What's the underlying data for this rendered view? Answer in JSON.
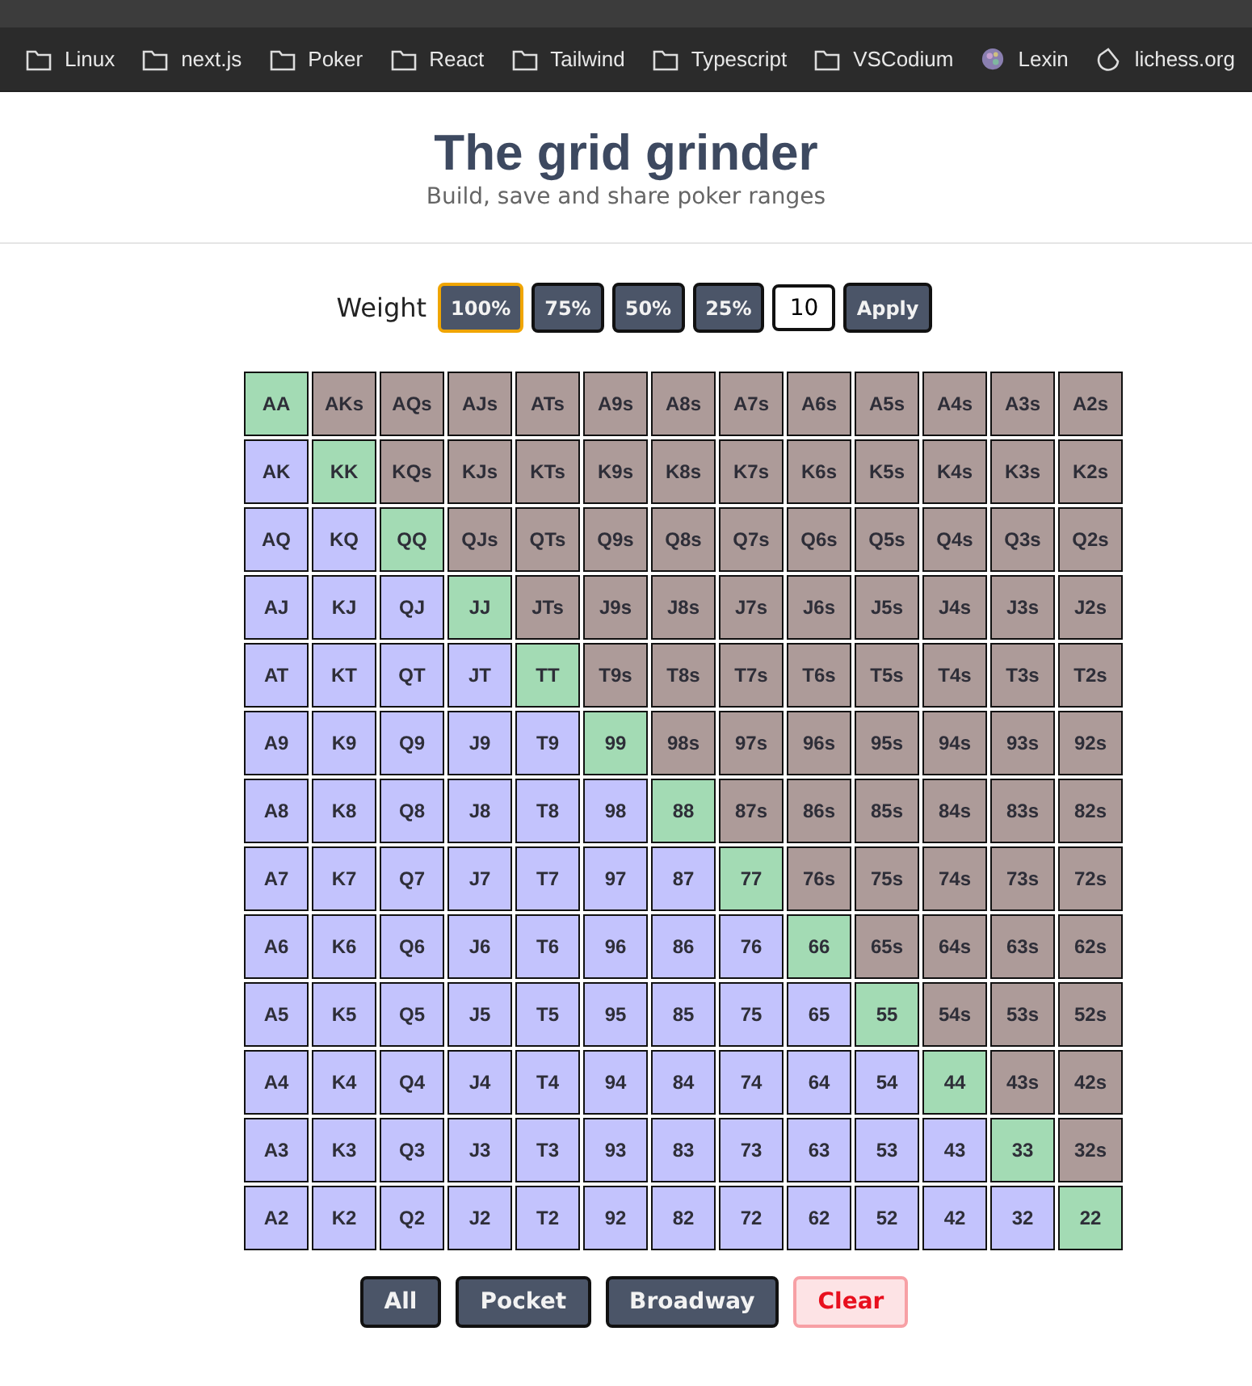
{
  "bookmarks": [
    {
      "label": "Linux",
      "kind": "folder"
    },
    {
      "label": "next.js",
      "kind": "folder"
    },
    {
      "label": "Poker",
      "kind": "folder"
    },
    {
      "label": "React",
      "kind": "folder"
    },
    {
      "label": "Tailwind",
      "kind": "folder"
    },
    {
      "label": "Typescript",
      "kind": "folder"
    },
    {
      "label": "VSCodium",
      "kind": "folder"
    },
    {
      "label": "Lexin",
      "kind": "site"
    },
    {
      "label": "lichess.org",
      "kind": "chess"
    }
  ],
  "header": {
    "title": "The grid grinder",
    "subtitle": "Build, save and share poker ranges"
  },
  "weight": {
    "label": "Weight",
    "options": [
      {
        "label": "100%",
        "selected": true
      },
      {
        "label": "75%",
        "selected": false
      },
      {
        "label": "50%",
        "selected": false
      },
      {
        "label": "25%",
        "selected": false
      }
    ],
    "value": "10",
    "apply": "Apply"
  },
  "grid": [
    [
      {
        "label": "AA",
        "kind": "pair"
      },
      {
        "label": "AKs",
        "kind": "suited"
      },
      {
        "label": "AQs",
        "kind": "suited"
      },
      {
        "label": "AJs",
        "kind": "suited"
      },
      {
        "label": "ATs",
        "kind": "suited"
      },
      {
        "label": "A9s",
        "kind": "suited"
      },
      {
        "label": "A8s",
        "kind": "suited"
      },
      {
        "label": "A7s",
        "kind": "suited"
      },
      {
        "label": "A6s",
        "kind": "suited"
      },
      {
        "label": "A5s",
        "kind": "suited"
      },
      {
        "label": "A4s",
        "kind": "suited"
      },
      {
        "label": "A3s",
        "kind": "suited"
      },
      {
        "label": "A2s",
        "kind": "suited"
      }
    ],
    [
      {
        "label": "AK",
        "kind": "offsuit"
      },
      {
        "label": "KK",
        "kind": "pair"
      },
      {
        "label": "KQs",
        "kind": "suited"
      },
      {
        "label": "KJs",
        "kind": "suited"
      },
      {
        "label": "KTs",
        "kind": "suited"
      },
      {
        "label": "K9s",
        "kind": "suited"
      },
      {
        "label": "K8s",
        "kind": "suited"
      },
      {
        "label": "K7s",
        "kind": "suited"
      },
      {
        "label": "K6s",
        "kind": "suited"
      },
      {
        "label": "K5s",
        "kind": "suited"
      },
      {
        "label": "K4s",
        "kind": "suited"
      },
      {
        "label": "K3s",
        "kind": "suited"
      },
      {
        "label": "K2s",
        "kind": "suited"
      }
    ],
    [
      {
        "label": "AQ",
        "kind": "offsuit"
      },
      {
        "label": "KQ",
        "kind": "offsuit"
      },
      {
        "label": "QQ",
        "kind": "pair"
      },
      {
        "label": "QJs",
        "kind": "suited"
      },
      {
        "label": "QTs",
        "kind": "suited"
      },
      {
        "label": "Q9s",
        "kind": "suited"
      },
      {
        "label": "Q8s",
        "kind": "suited"
      },
      {
        "label": "Q7s",
        "kind": "suited"
      },
      {
        "label": "Q6s",
        "kind": "suited"
      },
      {
        "label": "Q5s",
        "kind": "suited"
      },
      {
        "label": "Q4s",
        "kind": "suited"
      },
      {
        "label": "Q3s",
        "kind": "suited"
      },
      {
        "label": "Q2s",
        "kind": "suited"
      }
    ],
    [
      {
        "label": "AJ",
        "kind": "offsuit"
      },
      {
        "label": "KJ",
        "kind": "offsuit"
      },
      {
        "label": "QJ",
        "kind": "offsuit"
      },
      {
        "label": "JJ",
        "kind": "pair"
      },
      {
        "label": "JTs",
        "kind": "suited"
      },
      {
        "label": "J9s",
        "kind": "suited"
      },
      {
        "label": "J8s",
        "kind": "suited"
      },
      {
        "label": "J7s",
        "kind": "suited"
      },
      {
        "label": "J6s",
        "kind": "suited"
      },
      {
        "label": "J5s",
        "kind": "suited"
      },
      {
        "label": "J4s",
        "kind": "suited"
      },
      {
        "label": "J3s",
        "kind": "suited"
      },
      {
        "label": "J2s",
        "kind": "suited"
      }
    ],
    [
      {
        "label": "AT",
        "kind": "offsuit"
      },
      {
        "label": "KT",
        "kind": "offsuit"
      },
      {
        "label": "QT",
        "kind": "offsuit"
      },
      {
        "label": "JT",
        "kind": "offsuit"
      },
      {
        "label": "TT",
        "kind": "pair"
      },
      {
        "label": "T9s",
        "kind": "suited"
      },
      {
        "label": "T8s",
        "kind": "suited"
      },
      {
        "label": "T7s",
        "kind": "suited"
      },
      {
        "label": "T6s",
        "kind": "suited"
      },
      {
        "label": "T5s",
        "kind": "suited"
      },
      {
        "label": "T4s",
        "kind": "suited"
      },
      {
        "label": "T3s",
        "kind": "suited"
      },
      {
        "label": "T2s",
        "kind": "suited"
      }
    ],
    [
      {
        "label": "A9",
        "kind": "offsuit"
      },
      {
        "label": "K9",
        "kind": "offsuit"
      },
      {
        "label": "Q9",
        "kind": "offsuit"
      },
      {
        "label": "J9",
        "kind": "offsuit"
      },
      {
        "label": "T9",
        "kind": "offsuit"
      },
      {
        "label": "99",
        "kind": "pair"
      },
      {
        "label": "98s",
        "kind": "suited"
      },
      {
        "label": "97s",
        "kind": "suited"
      },
      {
        "label": "96s",
        "kind": "suited"
      },
      {
        "label": "95s",
        "kind": "suited"
      },
      {
        "label": "94s",
        "kind": "suited"
      },
      {
        "label": "93s",
        "kind": "suited"
      },
      {
        "label": "92s",
        "kind": "suited"
      }
    ],
    [
      {
        "label": "A8",
        "kind": "offsuit"
      },
      {
        "label": "K8",
        "kind": "offsuit"
      },
      {
        "label": "Q8",
        "kind": "offsuit"
      },
      {
        "label": "J8",
        "kind": "offsuit"
      },
      {
        "label": "T8",
        "kind": "offsuit"
      },
      {
        "label": "98",
        "kind": "offsuit"
      },
      {
        "label": "88",
        "kind": "pair"
      },
      {
        "label": "87s",
        "kind": "suited"
      },
      {
        "label": "86s",
        "kind": "suited"
      },
      {
        "label": "85s",
        "kind": "suited"
      },
      {
        "label": "84s",
        "kind": "suited"
      },
      {
        "label": "83s",
        "kind": "suited"
      },
      {
        "label": "82s",
        "kind": "suited"
      }
    ],
    [
      {
        "label": "A7",
        "kind": "offsuit"
      },
      {
        "label": "K7",
        "kind": "offsuit"
      },
      {
        "label": "Q7",
        "kind": "offsuit"
      },
      {
        "label": "J7",
        "kind": "offsuit"
      },
      {
        "label": "T7",
        "kind": "offsuit"
      },
      {
        "label": "97",
        "kind": "offsuit"
      },
      {
        "label": "87",
        "kind": "offsuit"
      },
      {
        "label": "77",
        "kind": "pair"
      },
      {
        "label": "76s",
        "kind": "suited"
      },
      {
        "label": "75s",
        "kind": "suited"
      },
      {
        "label": "74s",
        "kind": "suited"
      },
      {
        "label": "73s",
        "kind": "suited"
      },
      {
        "label": "72s",
        "kind": "suited"
      }
    ],
    [
      {
        "label": "A6",
        "kind": "offsuit"
      },
      {
        "label": "K6",
        "kind": "offsuit"
      },
      {
        "label": "Q6",
        "kind": "offsuit"
      },
      {
        "label": "J6",
        "kind": "offsuit"
      },
      {
        "label": "T6",
        "kind": "offsuit"
      },
      {
        "label": "96",
        "kind": "offsuit"
      },
      {
        "label": "86",
        "kind": "offsuit"
      },
      {
        "label": "76",
        "kind": "offsuit"
      },
      {
        "label": "66",
        "kind": "pair"
      },
      {
        "label": "65s",
        "kind": "suited"
      },
      {
        "label": "64s",
        "kind": "suited"
      },
      {
        "label": "63s",
        "kind": "suited"
      },
      {
        "label": "62s",
        "kind": "suited"
      }
    ],
    [
      {
        "label": "A5",
        "kind": "offsuit"
      },
      {
        "label": "K5",
        "kind": "offsuit"
      },
      {
        "label": "Q5",
        "kind": "offsuit"
      },
      {
        "label": "J5",
        "kind": "offsuit"
      },
      {
        "label": "T5",
        "kind": "offsuit"
      },
      {
        "label": "95",
        "kind": "offsuit"
      },
      {
        "label": "85",
        "kind": "offsuit"
      },
      {
        "label": "75",
        "kind": "offsuit"
      },
      {
        "label": "65",
        "kind": "offsuit"
      },
      {
        "label": "55",
        "kind": "pair"
      },
      {
        "label": "54s",
        "kind": "suited"
      },
      {
        "label": "53s",
        "kind": "suited"
      },
      {
        "label": "52s",
        "kind": "suited"
      }
    ],
    [
      {
        "label": "A4",
        "kind": "offsuit"
      },
      {
        "label": "K4",
        "kind": "offsuit"
      },
      {
        "label": "Q4",
        "kind": "offsuit"
      },
      {
        "label": "J4",
        "kind": "offsuit"
      },
      {
        "label": "T4",
        "kind": "offsuit"
      },
      {
        "label": "94",
        "kind": "offsuit"
      },
      {
        "label": "84",
        "kind": "offsuit"
      },
      {
        "label": "74",
        "kind": "offsuit"
      },
      {
        "label": "64",
        "kind": "offsuit"
      },
      {
        "label": "54",
        "kind": "offsuit"
      },
      {
        "label": "44",
        "kind": "pair"
      },
      {
        "label": "43s",
        "kind": "suited"
      },
      {
        "label": "42s",
        "kind": "suited"
      }
    ],
    [
      {
        "label": "A3",
        "kind": "offsuit"
      },
      {
        "label": "K3",
        "kind": "offsuit"
      },
      {
        "label": "Q3",
        "kind": "offsuit"
      },
      {
        "label": "J3",
        "kind": "offsuit"
      },
      {
        "label": "T3",
        "kind": "offsuit"
      },
      {
        "label": "93",
        "kind": "offsuit"
      },
      {
        "label": "83",
        "kind": "offsuit"
      },
      {
        "label": "73",
        "kind": "offsuit"
      },
      {
        "label": "63",
        "kind": "offsuit"
      },
      {
        "label": "53",
        "kind": "offsuit"
      },
      {
        "label": "43",
        "kind": "offsuit"
      },
      {
        "label": "33",
        "kind": "pair"
      },
      {
        "label": "32s",
        "kind": "suited"
      }
    ],
    [
      {
        "label": "A2",
        "kind": "offsuit"
      },
      {
        "label": "K2",
        "kind": "offsuit"
      },
      {
        "label": "Q2",
        "kind": "offsuit"
      },
      {
        "label": "J2",
        "kind": "offsuit"
      },
      {
        "label": "T2",
        "kind": "offsuit"
      },
      {
        "label": "92",
        "kind": "offsuit"
      },
      {
        "label": "82",
        "kind": "offsuit"
      },
      {
        "label": "72",
        "kind": "offsuit"
      },
      {
        "label": "62",
        "kind": "offsuit"
      },
      {
        "label": "52",
        "kind": "offsuit"
      },
      {
        "label": "42",
        "kind": "offsuit"
      },
      {
        "label": "32",
        "kind": "offsuit"
      },
      {
        "label": "22",
        "kind": "pair"
      }
    ]
  ],
  "actions": [
    {
      "label": "All",
      "kind": "normal"
    },
    {
      "label": "Pocket",
      "kind": "normal"
    },
    {
      "label": "Broadway",
      "kind": "normal"
    },
    {
      "label": "Clear",
      "kind": "danger"
    }
  ]
}
